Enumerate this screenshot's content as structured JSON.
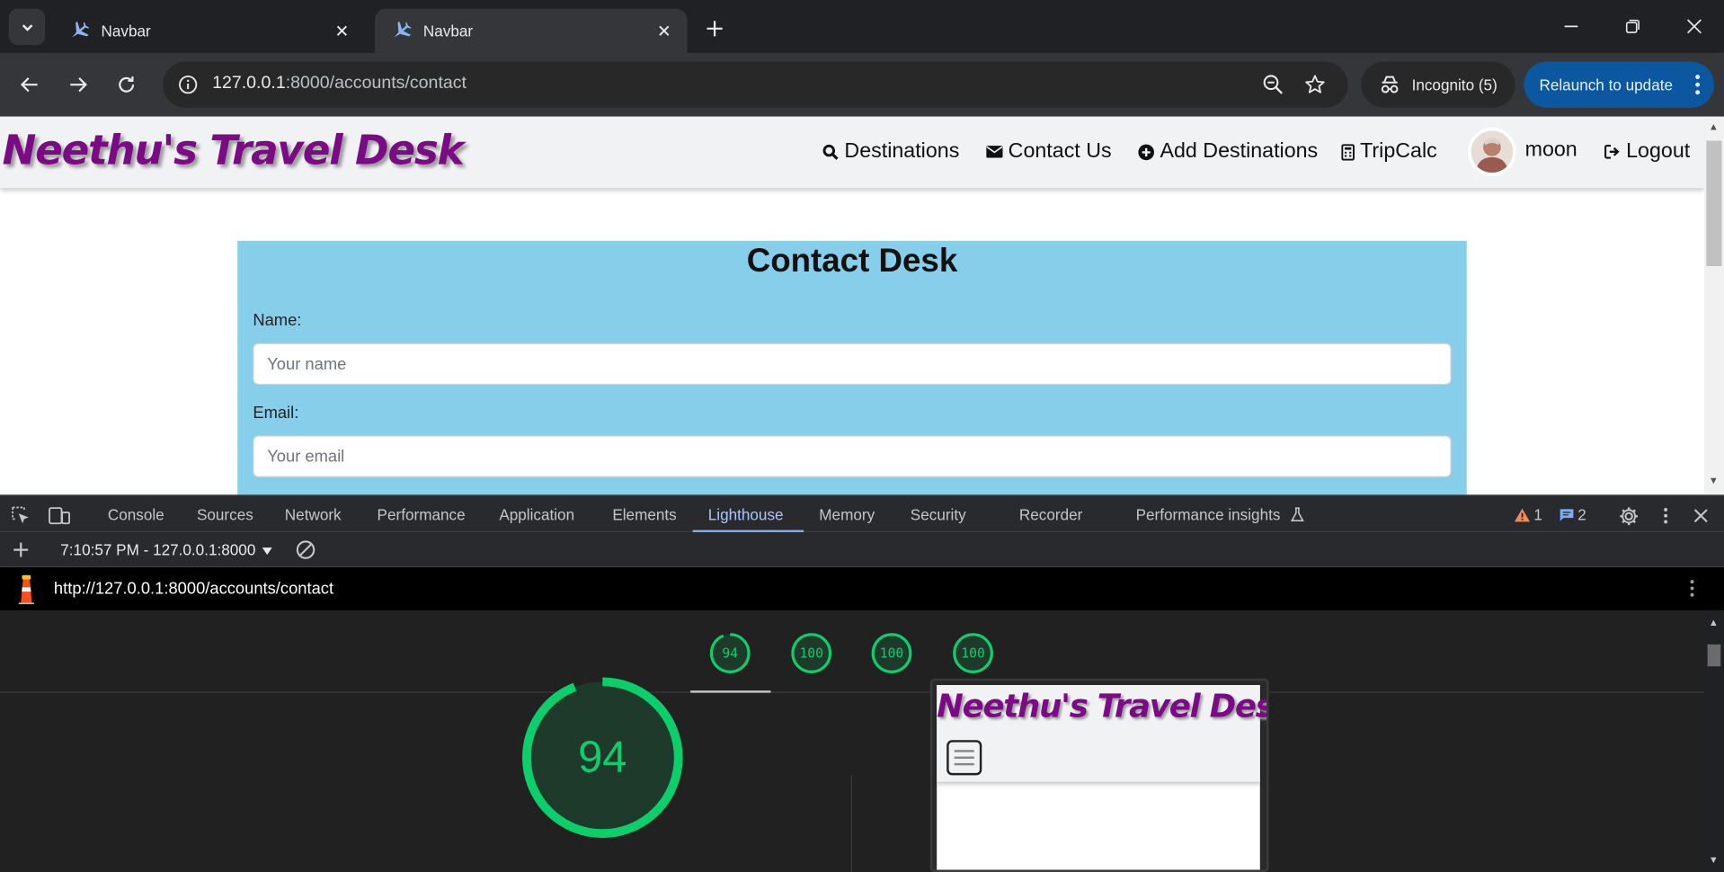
{
  "browser": {
    "tabs": [
      {
        "title": "Navbar",
        "active": false
      },
      {
        "title": "Navbar",
        "active": true
      }
    ],
    "address": {
      "host": "127.0.0.1",
      "path": ":8000/accounts/contact"
    },
    "incognito_label": "Incognito (5)",
    "relaunch_label": "Relaunch to update",
    "colors": {
      "tab_strip": "#202124",
      "toolbar": "#35363a",
      "relaunch_bg": "#0b57a0"
    }
  },
  "site": {
    "brand": "Neethu's Travel Desk",
    "nav": {
      "destinations": "Destinations",
      "contact": "Contact Us",
      "add_destinations": "Add Destinations",
      "tripcalc": "TripCalc",
      "username": "moon",
      "logout": "Logout"
    },
    "contact_form": {
      "title": "Contact Desk",
      "name_label": "Name:",
      "name_placeholder": "Your name",
      "email_label": "Email:",
      "email_placeholder": "Your email"
    },
    "colors": {
      "brand": "#7b0a85",
      "form_bg": "#87ceeb",
      "navbar_bg": "#f1f2f4"
    }
  },
  "devtools": {
    "tabs": [
      "Console",
      "Sources",
      "Network",
      "Performance",
      "Application",
      "Elements",
      "Lighthouse",
      "Memory",
      "Security",
      "Recorder",
      "Performance insights"
    ],
    "active_tab": "Lighthouse",
    "warnings_count": "1",
    "messages_count": "2",
    "session": "7:10:57 PM - 127.0.0.1:8000",
    "report_url": "http://127.0.0.1:8000/accounts/contact",
    "scores": [
      "94",
      "100",
      "100",
      "100"
    ],
    "main_score": "94",
    "thumbnail_brand": "Neethu's Travel Desk",
    "colors": {
      "pass": "#0cce6b",
      "accent": "#a8c7fa"
    }
  }
}
